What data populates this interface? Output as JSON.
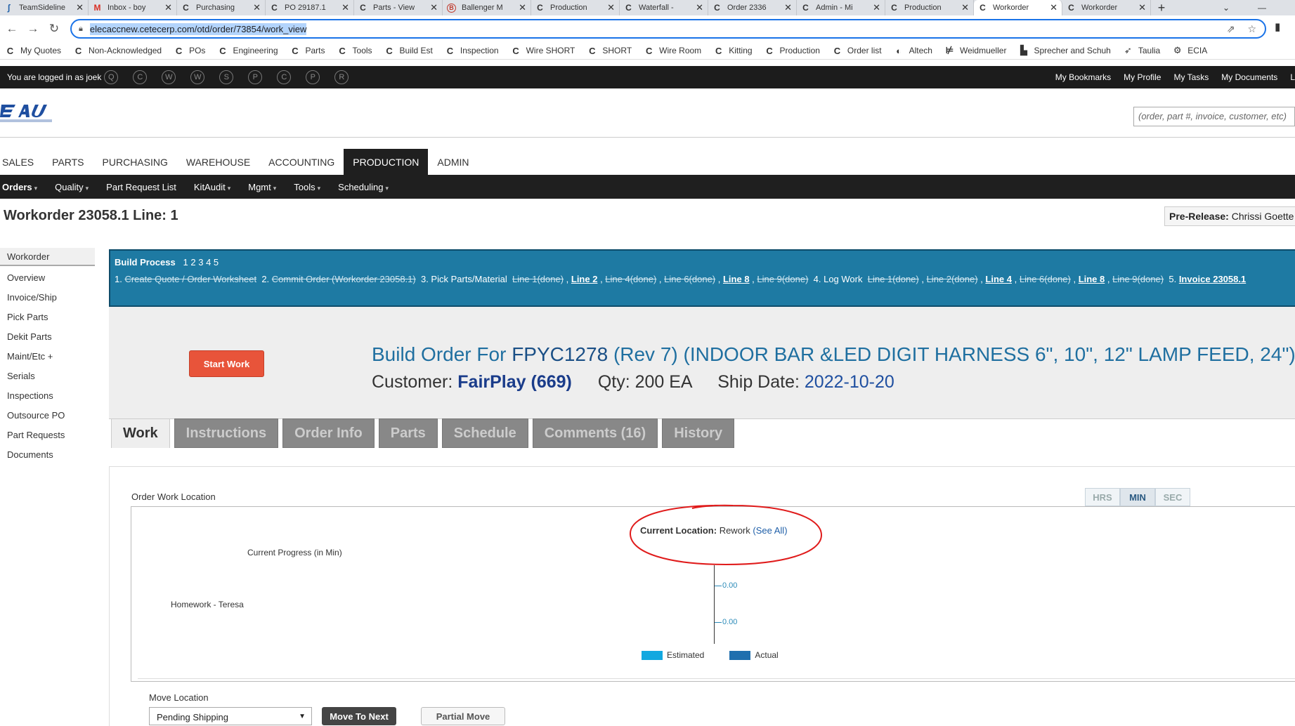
{
  "browser": {
    "tabs": [
      {
        "icon": "ʃ",
        "label": "TeamSideline"
      },
      {
        "icon": "M",
        "label": "Inbox - boy"
      },
      {
        "icon": "C",
        "label": "Purchasing"
      },
      {
        "icon": "C",
        "label": "PO 29187.1"
      },
      {
        "icon": "C",
        "label": "Parts - View"
      },
      {
        "icon": "B",
        "label": "Ballenger M"
      },
      {
        "icon": "C",
        "label": "Production"
      },
      {
        "icon": "C",
        "label": "Waterfall - "
      },
      {
        "icon": "C",
        "label": "Order 2336"
      },
      {
        "icon": "C",
        "label": "Admin - Mi"
      },
      {
        "icon": "C",
        "label": "Production"
      },
      {
        "icon": "C",
        "label": "Workorder"
      },
      {
        "icon": "C",
        "label": "Workorder"
      }
    ],
    "url": "elecaccnew.cetecerp.com/otd/order/73854/work_view",
    "bookmarks": [
      {
        "icon": "C",
        "label": "My Quotes"
      },
      {
        "icon": "C",
        "label": "Non-Acknowledged"
      },
      {
        "icon": "C",
        "label": "POs"
      },
      {
        "icon": "C",
        "label": "Engineering"
      },
      {
        "icon": "C",
        "label": "Parts"
      },
      {
        "icon": "C",
        "label": "Tools"
      },
      {
        "icon": "C",
        "label": "Build Est"
      },
      {
        "icon": "C",
        "label": "Inspection"
      },
      {
        "icon": "C",
        "label": "Wire SHORT"
      },
      {
        "icon": "C",
        "label": "SHORT"
      },
      {
        "icon": "C",
        "label": "Wire Room"
      },
      {
        "icon": "C",
        "label": "Kitting"
      },
      {
        "icon": "C",
        "label": "Production"
      },
      {
        "icon": "C",
        "label": "Order list"
      },
      {
        "icon": "◐",
        "label": "Altech"
      },
      {
        "icon": "⊭",
        "label": "Weidmueller"
      },
      {
        "icon": "▙",
        "label": "Sprecher and Schuh"
      },
      {
        "icon": "➶",
        "label": "Taulia"
      },
      {
        "icon": "⚙",
        "label": "ECIA"
      }
    ]
  },
  "topbar": {
    "logged_in": "You are logged in as joek",
    "circles": [
      "Q",
      "C",
      "W",
      "W",
      "S",
      "P",
      "C",
      "P",
      "R"
    ],
    "links": [
      "My Bookmarks",
      "My Profile",
      "My Tasks",
      "My Documents",
      "L"
    ]
  },
  "search": {
    "placeholder": "(order, part #, invoice, customer, etc)"
  },
  "mainnav": [
    "SALES",
    "PARTS",
    "PURCHASING",
    "WAREHOUSE",
    "ACCOUNTING",
    "PRODUCTION",
    "ADMIN"
  ],
  "subnav": [
    {
      "label": "Orders",
      "dropdown": true
    },
    {
      "label": "Quality",
      "dropdown": true
    },
    {
      "label": "Part Request List",
      "dropdown": false
    },
    {
      "label": "KitAudit",
      "dropdown": true
    },
    {
      "label": "Mgmt",
      "dropdown": true
    },
    {
      "label": "Tools",
      "dropdown": true
    },
    {
      "label": "Scheduling",
      "dropdown": true
    }
  ],
  "page": {
    "title": "Workorder 23058.1 Line: 1",
    "prerelease_label": "Pre-Release:",
    "prerelease_value": "Chrissi Goette"
  },
  "sidebar": [
    "Workorder",
    "Overview",
    "Invoice/Ship",
    "Pick Parts",
    "Dekit Parts",
    "Maint/Etc +",
    "Serials",
    "Inspections",
    "Outsource PO",
    "Part Requests",
    "Documents"
  ],
  "build_process": {
    "title": "Build Process",
    "steps_nav": "1 2 3 4 5",
    "s1_num": "1.",
    "s1": "Create Quote / Order Worksheet",
    "s2_num": "2.",
    "s2": "Commit Order (Workorder 23058.1)",
    "s3": "3. Pick Parts/Material",
    "s3_lines": [
      {
        "label": "Line 1(done)",
        "done": true
      },
      {
        "label": "Line 2",
        "done": false
      },
      {
        "label": "Line 4(done)",
        "done": true
      },
      {
        "label": "Line 6(done)",
        "done": true
      },
      {
        "label": "Line 8",
        "done": false
      },
      {
        "label": "Line 9(done)",
        "done": true
      }
    ],
    "s4": "4. Log Work",
    "s4_lines": [
      {
        "label": "Line 1(done)",
        "done": true
      },
      {
        "label": "Line 2(done)",
        "done": true
      },
      {
        "label": "Line 4",
        "done": false
      },
      {
        "label": "Line 6(done)",
        "done": true
      },
      {
        "label": "Line 8",
        "done": false
      },
      {
        "label": "Line 9(done)",
        "done": true
      }
    ],
    "s5": "5.",
    "s5_link": "Invoice 23058.1"
  },
  "order": {
    "start_button": "Start Work",
    "title_prefix": "Build Order For",
    "part": "FPYC1278",
    "rev": "(Rev 7)",
    "description": "(INDOOR BAR &LED DIGIT HARNESS 6\", 10\", 12\" LAMP FEED, 24\")",
    "customer_label": "Customer:",
    "customer": "FairPlay (669)",
    "qty": "Qty: 200 EA",
    "ship_label": "Ship Date:",
    "ship_date": "2022-10-20"
  },
  "tabs": [
    "Work",
    "Instructions",
    "Order Info",
    "Parts",
    "Schedule",
    "Comments (16)",
    "History"
  ],
  "work": {
    "section_label": "Order Work Location",
    "unit_buttons": [
      "HRS",
      "MIN",
      "SEC"
    ],
    "current_location_label": "Current Location:",
    "current_location": "Rework",
    "see_all": "(See All)",
    "move_location_label": "Move Location",
    "move_select_value": "Pending Shipping",
    "move_next": "Move To Next",
    "partial_move": "Partial Move"
  },
  "chart_data": {
    "type": "bar",
    "title": "Current Progress (in Min)",
    "categories": [
      "Homework - Teresa"
    ],
    "series": [
      {
        "name": "Estimated",
        "values": [
          0
        ]
      },
      {
        "name": "Actual",
        "values": [
          0
        ]
      }
    ],
    "tick_labels": [
      "0.00",
      "0.00"
    ],
    "colors": {
      "Estimated": "#12a8e0",
      "Actual": "#1f6fae"
    }
  },
  "colors": {
    "banner": "#1e7aa3",
    "accent_button": "#e8543a",
    "annotation": "#e01b1b"
  }
}
